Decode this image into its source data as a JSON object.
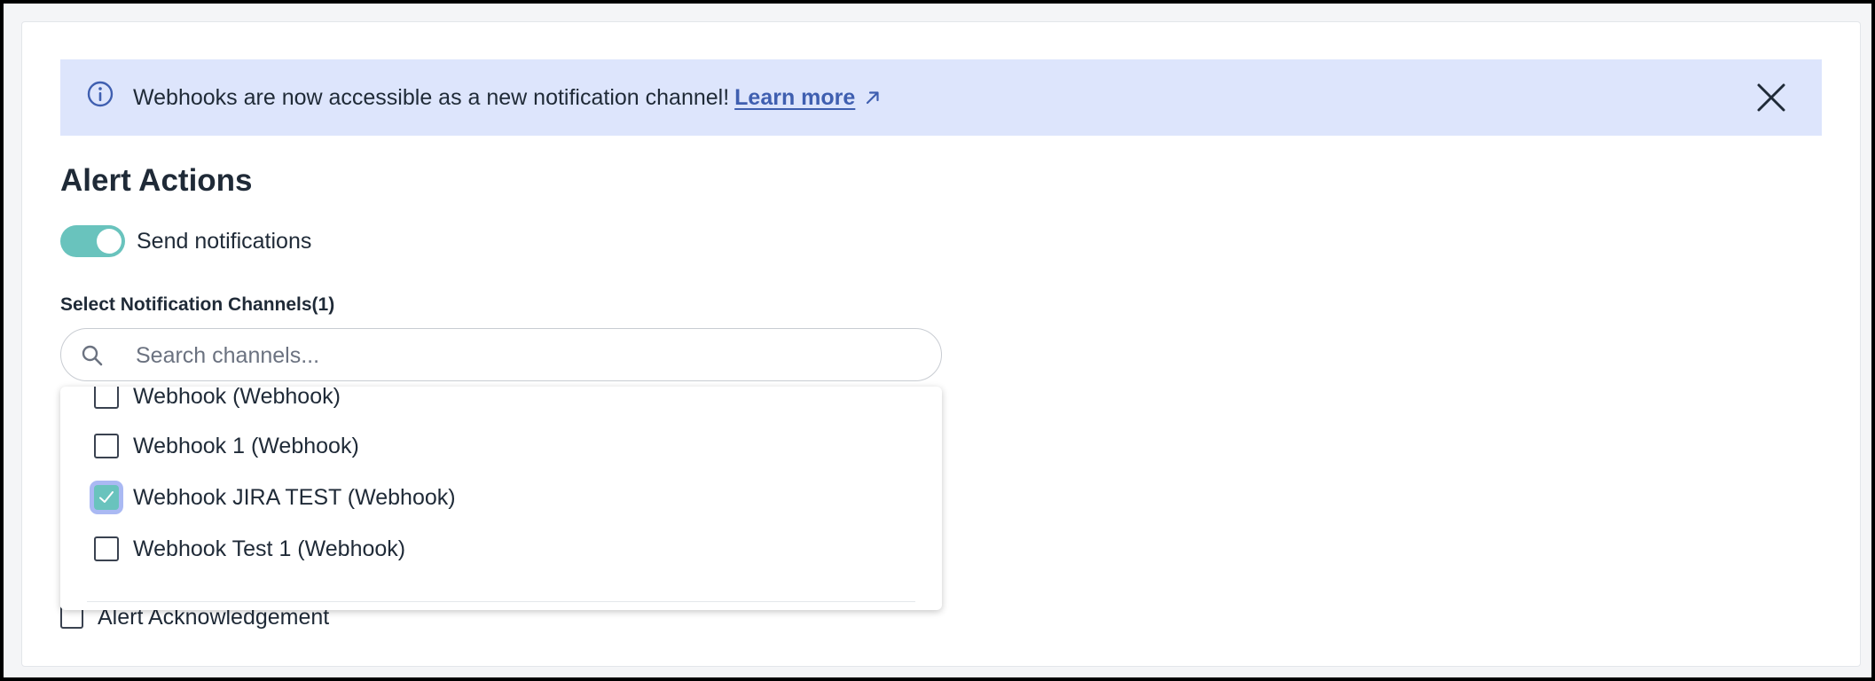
{
  "banner": {
    "message": "Webhooks are now accessible as a new notification channel!",
    "link_label": "Learn more",
    "icon": "info-icon",
    "background": "#dde5fc",
    "link_color": "#3f5fb0"
  },
  "page": {
    "title": "Alert Actions"
  },
  "notifications_toggle": {
    "label": "Send notifications",
    "on": true,
    "color": "#69c3bd"
  },
  "channels": {
    "label": "Select Notification Channels(1)",
    "search_placeholder": "Search channels...",
    "options": [
      {
        "label": "Webhook (Webhook)",
        "checked": false
      },
      {
        "label": "Webhook 1 (Webhook)",
        "checked": false
      },
      {
        "label": "Webhook JIRA TEST (Webhook)",
        "checked": true
      },
      {
        "label": "Webhook Test 1 (Webhook)",
        "checked": false
      }
    ]
  },
  "acknowledgement": {
    "label": "Alert Acknowledgement",
    "checked": false
  }
}
